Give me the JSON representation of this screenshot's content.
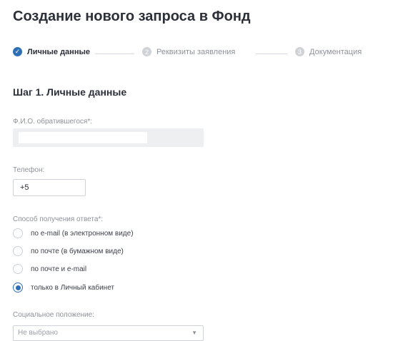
{
  "page": {
    "title": "Создание нового запроса в Фонд"
  },
  "stepper": {
    "steps": [
      {
        "number": "",
        "label": "Личные данные",
        "status": "done"
      },
      {
        "number": "2",
        "label": "Реквизиты заявления",
        "status": "todo"
      },
      {
        "number": "3",
        "label": "Документация",
        "status": "todo"
      }
    ],
    "check_glyph": "✓"
  },
  "form": {
    "step_title": "Шаг 1. Личные данные",
    "fio": {
      "label": "Ф.И.О. обратившегося*:",
      "value": ""
    },
    "phone": {
      "label": "Телефон:",
      "value": "+5"
    },
    "response_method": {
      "label": "Способ получения ответа*:",
      "options": [
        {
          "label": "по e-mail (в электронном виде)",
          "checked": false
        },
        {
          "label": "по почте (в бумажном виде)",
          "checked": false
        },
        {
          "label": "по почте и e-mail",
          "checked": false
        },
        {
          "label": "только в Личный кабинет",
          "checked": true
        }
      ]
    },
    "social_status": {
      "label": "Социальное положение:",
      "selected": "Не выбрано"
    }
  },
  "colors": {
    "accent": "#2f6fb6",
    "inactive_step": "#cfd3d8",
    "muted_text": "#8d9299"
  },
  "icons": {
    "step_done": "check-icon",
    "select_arrow": "chevron-down-icon"
  }
}
